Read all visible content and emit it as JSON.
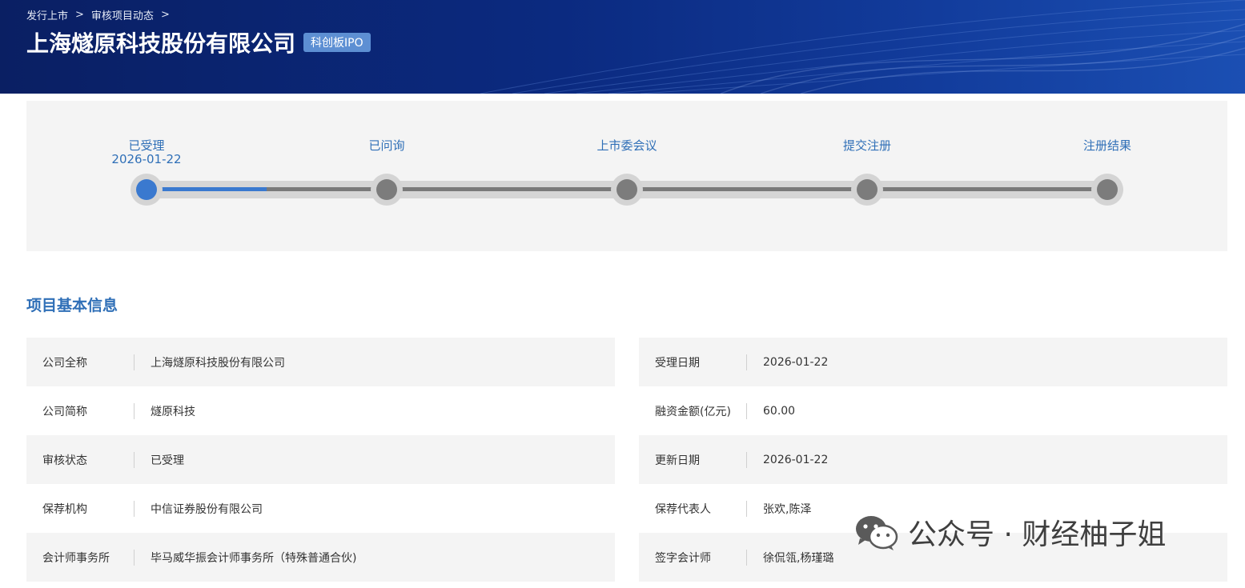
{
  "breadcrumb": [
    "发行上市",
    "审核项目动态"
  ],
  "header": {
    "company_title": "上海燧原科技股份有限公司",
    "board_badge": "科创板IPO"
  },
  "progress": {
    "completed_fraction": 0.125,
    "steps": [
      {
        "label": "已受理",
        "date": "2026-01-22",
        "active": true
      },
      {
        "label": "已问询",
        "date": "",
        "active": false
      },
      {
        "label": "上市委会议",
        "date": "",
        "active": false
      },
      {
        "label": "提交注册",
        "date": "",
        "active": false
      },
      {
        "label": "注册结果",
        "date": "",
        "active": false
      }
    ]
  },
  "section": {
    "title": "项目基本信息"
  },
  "info_left": [
    {
      "label": "公司全称",
      "value": "上海燧原科技股份有限公司"
    },
    {
      "label": "公司简称",
      "value": "燧原科技"
    },
    {
      "label": "审核状态",
      "value": "已受理"
    },
    {
      "label": "保荐机构",
      "value": "中信证券股份有限公司"
    },
    {
      "label": "会计师事务所",
      "value": "毕马威华振会计师事务所（特殊普通合伙)"
    }
  ],
  "info_right": [
    {
      "label": "受理日期",
      "value": "2026-01-22"
    },
    {
      "label": "融资金额(亿元)",
      "value": "60.00"
    },
    {
      "label": "更新日期",
      "value": "2026-01-22"
    },
    {
      "label": "保荐代表人",
      "value": "张欢,陈泽"
    },
    {
      "label": "签字会计师",
      "value": "徐侃瓴,杨瑾璐"
    }
  ],
  "watermark": {
    "text": "公众号 · 财经柚子姐",
    "icon": "wechat-icon"
  },
  "colors": {
    "accent": "#2f6fb7",
    "banner": "#0b2a80",
    "badge": "#5d8fd3",
    "progress_fill": "#3a79cf"
  }
}
